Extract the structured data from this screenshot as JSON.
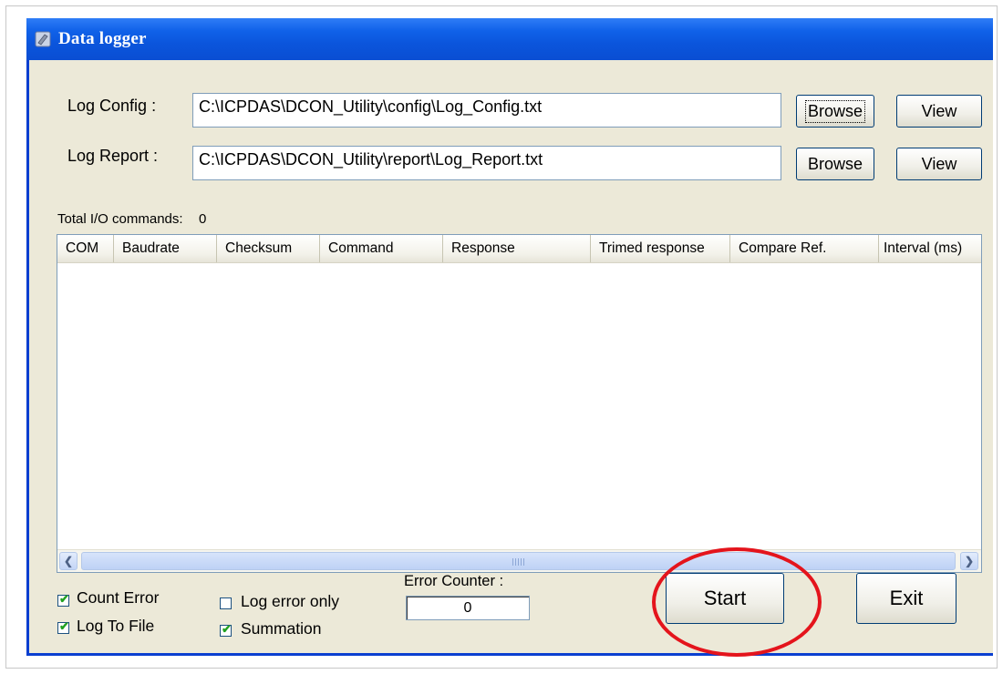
{
  "window": {
    "title": "Data logger"
  },
  "form": {
    "log_config": {
      "label": "Log Config :",
      "value": "C:\\ICPDAS\\DCON_Utility\\config\\Log_Config.txt",
      "browse_label": "Browse",
      "view_label": "View"
    },
    "log_report": {
      "label": "Log Report :",
      "value": "C:\\ICPDAS\\DCON_Utility\\report\\Log_Report.txt",
      "browse_label": "Browse",
      "view_label": "View"
    },
    "total_io": {
      "label": "Total I/O commands:",
      "value": "0"
    }
  },
  "table": {
    "columns": [
      "COM",
      "Baudrate",
      "Checksum",
      "Command",
      "Response",
      "Trimed response",
      "Compare Ref.",
      "Interval (ms)"
    ],
    "rows": []
  },
  "options": {
    "count_error": {
      "label": "Count Error",
      "checked": true
    },
    "log_to_file": {
      "label": "Log To File",
      "checked": true
    },
    "log_error_only": {
      "label": "Log error only",
      "checked": false
    },
    "summation": {
      "label": "Summation",
      "checked": true
    }
  },
  "error_counter": {
    "label": "Error Counter :",
    "value": "0"
  },
  "actions": {
    "start_label": "Start",
    "exit_label": "Exit"
  },
  "colors": {
    "titlebar": "#0a4ed3",
    "client_bg": "#ece9d8",
    "highlight_circle": "#e4141c"
  },
  "icons": {
    "app": "data-logger-icon",
    "scroll_left": "scroll-left-arrow-icon",
    "scroll_right": "scroll-right-arrow-icon"
  }
}
